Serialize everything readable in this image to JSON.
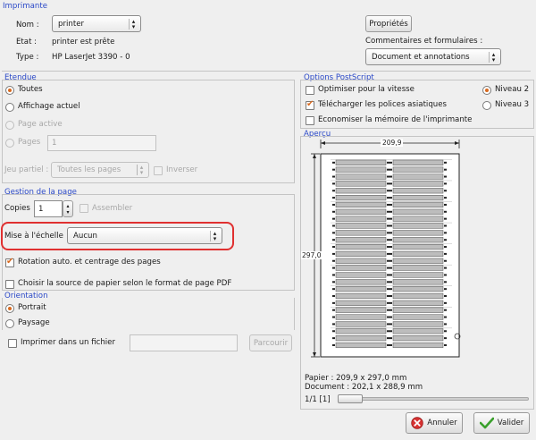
{
  "printer": {
    "title": "Imprimante",
    "name_label": "Nom :",
    "name_value": "printer",
    "state_label": "Etat :",
    "state_value": "printer est prête",
    "type_label": "Type :",
    "type_value": "HP LaserJet 3390 -  0",
    "properties_button": "Propriétés",
    "comments_label": "Commentaires et formulaires :",
    "comments_value": "Document et annotations"
  },
  "range": {
    "title": "Etendue",
    "all": "Toutes",
    "current_view": "Affichage actuel",
    "active_page": "Page active",
    "pages_label": "Pages",
    "pages_value": "1",
    "subset_label": "Jeu partiel :",
    "subset_value": "Toutes les pages",
    "reverse_label": "Inverser"
  },
  "handling": {
    "title": "Gestion de la page",
    "copies_label": "Copies",
    "copies_value": "1",
    "collate_label": "Assembler",
    "scaling_label": "Mise à l'échelle",
    "scaling_value": "Aucun",
    "autorotate_label": "Rotation auto. et centrage des pages",
    "paper_source_label": "Choisir la source de papier selon le format de page PDF"
  },
  "orientation": {
    "title": "Orientation",
    "portrait": "Portrait",
    "landscape": "Paysage"
  },
  "file": {
    "print_to_file_label": "Imprimer dans un fichier",
    "path_value": "",
    "browse_button": "Parcourir"
  },
  "postscript": {
    "title": "Options PostScript",
    "optimize_speed": "Optimiser pour la vitesse",
    "download_asian_fonts": "Télécharger les polices asiatiques",
    "save_memory": "Economiser la mémoire de l'imprimante",
    "level2": "Niveau 2",
    "level3": "Niveau 3"
  },
  "preview": {
    "title": "Aperçu",
    "width_label": "209,9",
    "height_label": "297,0",
    "paper_info": "Papier : 209,9 x 297,0 mm",
    "document_info": "Document : 202,1 x 288,9 mm",
    "page_counter": "1/1  [1]",
    "slider_position": 0
  },
  "actions": {
    "cancel": "Annuler",
    "ok": "Valider"
  },
  "colors": {
    "group_title": "#2a48c8",
    "highlight": "#e03030",
    "accent": "#d86a20",
    "ok_icon": "#3aa02c",
    "cancel_icon": "#d83232"
  }
}
